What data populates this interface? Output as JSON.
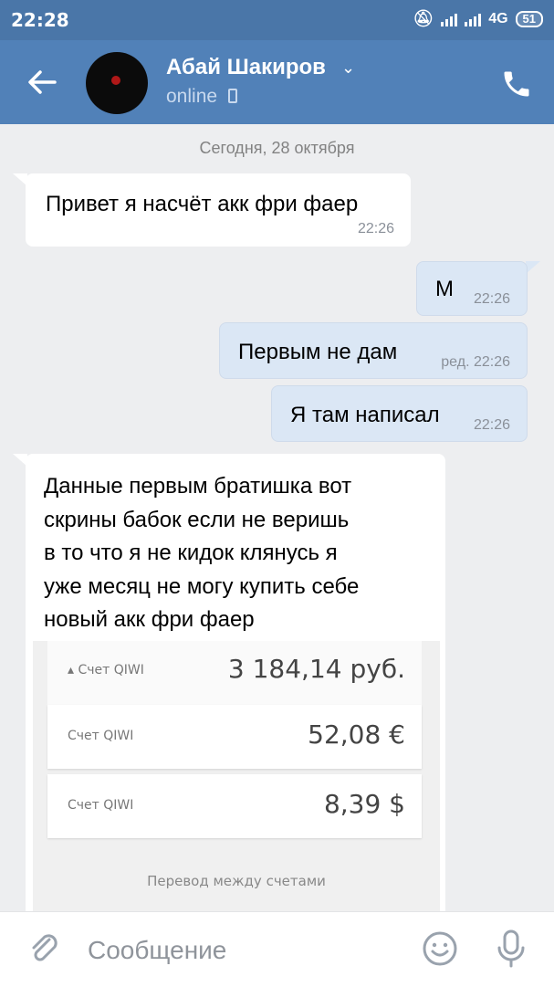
{
  "status_bar": {
    "time": "22:28",
    "network": "4G",
    "battery": "51"
  },
  "header": {
    "contact_name": "Абай Шакиров",
    "status": "online"
  },
  "chat": {
    "date_divider": "Сегодня, 28 октября",
    "messages": [
      {
        "direction": "in",
        "text": "Привет я насчёт акк фри фаер",
        "time": "22:26"
      },
      {
        "direction": "out",
        "text": "М",
        "time": "22:26"
      },
      {
        "direction": "out",
        "text": "Первым не дам",
        "time": "ред. 22:26"
      },
      {
        "direction": "out",
        "text": "Я там написал",
        "time": "22:26"
      },
      {
        "direction": "in",
        "text_lines": [
          "Данные первым братишка вот",
          "скрины бабок если не веришь",
          "в то что я не кидок клянусь я",
          "уже месяц не могу купить себе",
          "новый акк фри фаер"
        ]
      }
    ],
    "attachment": {
      "rows": [
        {
          "label": "▴ Счет QIWI",
          "amount": "3 184,14 руб."
        },
        {
          "label": "Счет QIWI",
          "amount": "52,08 €"
        },
        {
          "label": "Счет QIWI",
          "amount": "8,39 $"
        }
      ],
      "link": "Перевод между счетами"
    }
  },
  "composer": {
    "placeholder": "Сообщение"
  },
  "colors": {
    "header": "#5181b8",
    "status_bar": "#4a76a8",
    "background": "#edeef0",
    "incoming_bubble": "#ffffff",
    "outgoing_bubble": "#dbe7f5"
  }
}
